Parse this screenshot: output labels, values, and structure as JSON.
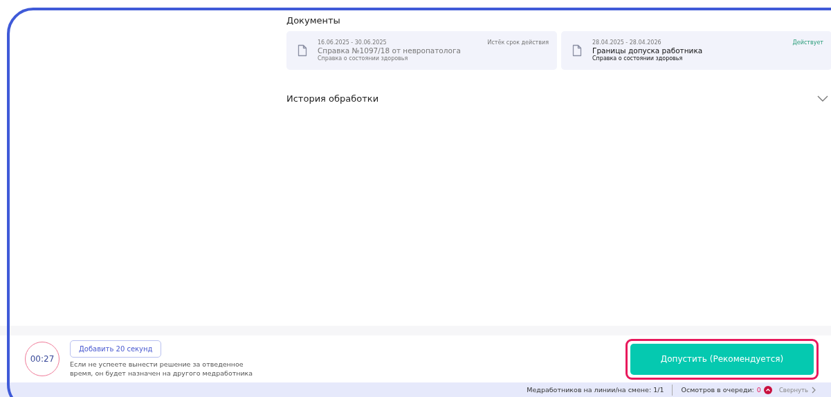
{
  "documents": {
    "title": "Документы",
    "items": [
      {
        "dates": "16.06.2025 - 30.06.2025",
        "status": "Истёк срок действия",
        "active": false,
        "name": "Справка №1097/18 от невропатолога",
        "type": "Справка о состоянии здоровья"
      },
      {
        "dates": "28.04.2025 - 28.04.2026",
        "status": "Действует",
        "active": true,
        "name": "Границы допуска работника",
        "type": "Справка о состоянии здоровья"
      }
    ]
  },
  "history": {
    "title": "История обработки",
    "expanded": false
  },
  "footer": {
    "timer": "00:27",
    "add_button": "Добавить 20 секунд",
    "hint": "Если не успеете вынести решение за отведенное время, он будет назначен на другого медработника",
    "primary_button": "Допустить (Рекомендуется)",
    "highlighted": true
  },
  "status_bar": {
    "staff": "Медработников на линии/на смене: 1/1",
    "queue_label": "Осмотров в очереди:",
    "queue_count": "0",
    "collapse": "Свернуть"
  }
}
